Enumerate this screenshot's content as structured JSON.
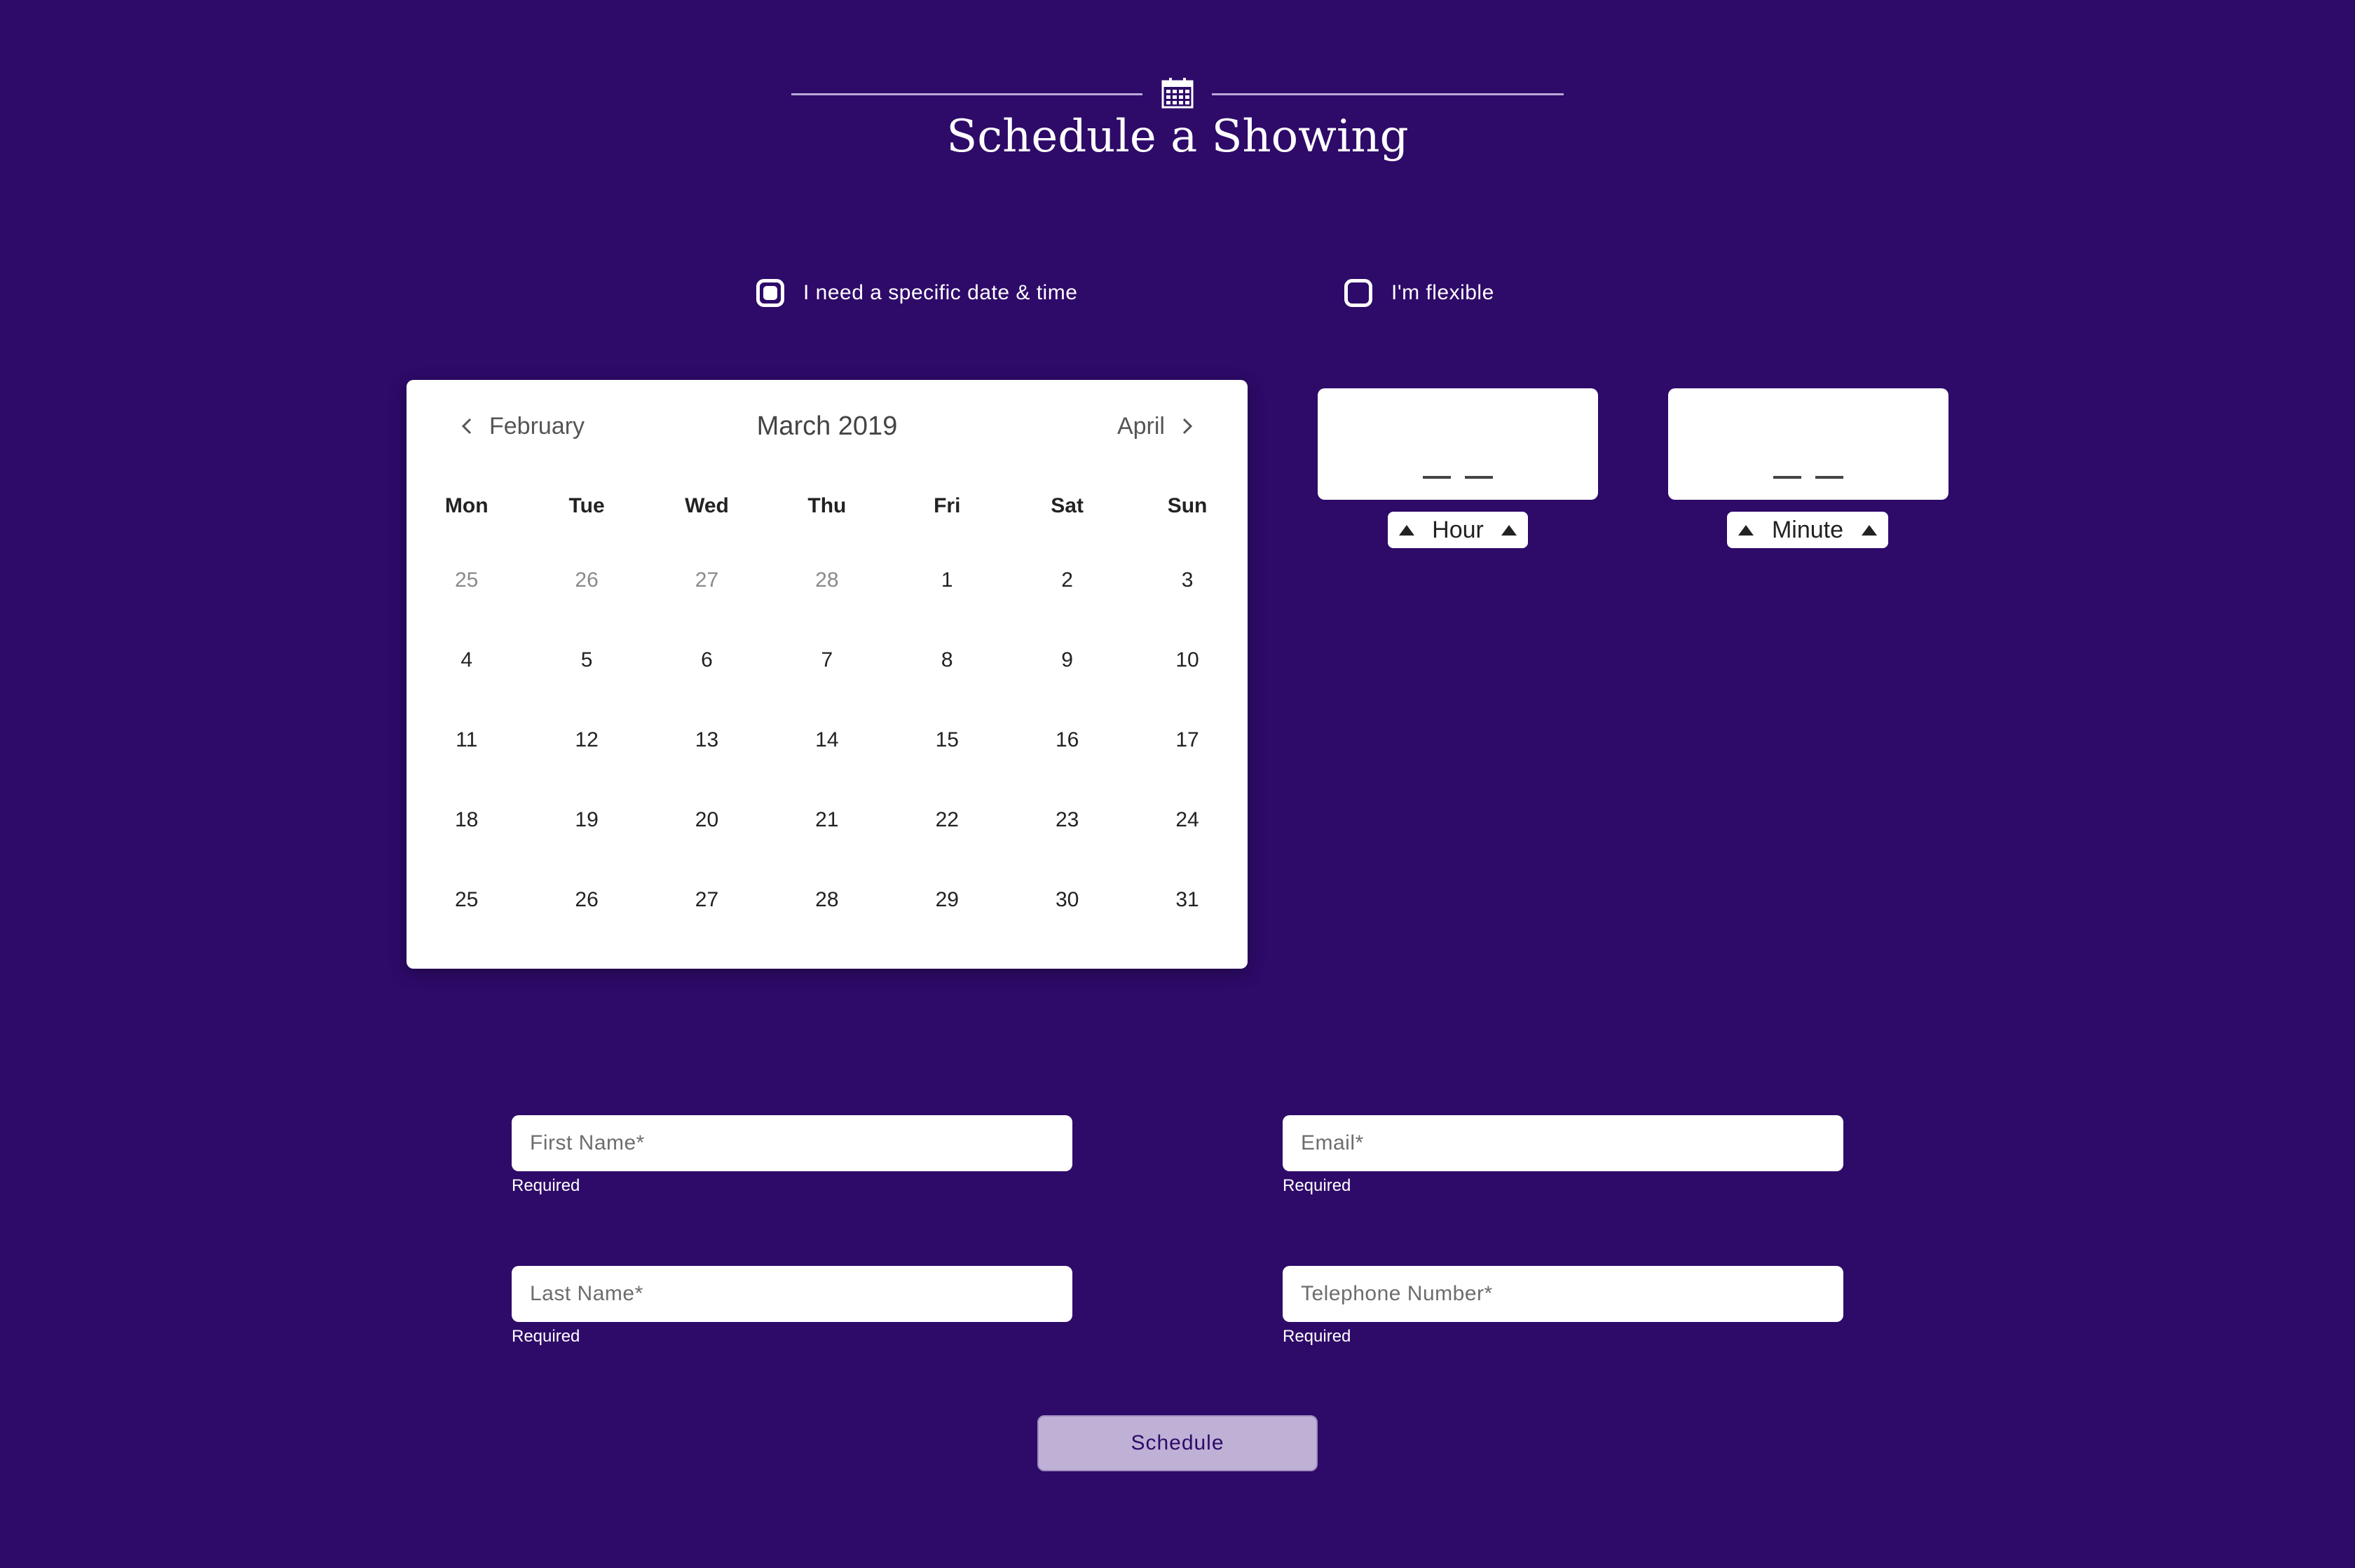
{
  "header": {
    "title": "Schedule a Showing",
    "icon": "calendar-icon"
  },
  "options": [
    {
      "label": "I need a specific date & time",
      "checked": true
    },
    {
      "label": "I'm flexible",
      "checked": false
    }
  ],
  "calendar": {
    "prev_label": "February",
    "month_label": "March 2019",
    "next_label": "April",
    "weekdays": [
      "Mon",
      "Tue",
      "Wed",
      "Thu",
      "Fri",
      "Sat",
      "Sun"
    ],
    "days": [
      {
        "n": "25",
        "muted": true
      },
      {
        "n": "26",
        "muted": true
      },
      {
        "n": "27",
        "muted": true
      },
      {
        "n": "28",
        "muted": true
      },
      {
        "n": "1"
      },
      {
        "n": "2"
      },
      {
        "n": "3"
      },
      {
        "n": "4"
      },
      {
        "n": "5"
      },
      {
        "n": "6"
      },
      {
        "n": "7"
      },
      {
        "n": "8"
      },
      {
        "n": "9"
      },
      {
        "n": "10"
      },
      {
        "n": "11"
      },
      {
        "n": "12"
      },
      {
        "n": "13"
      },
      {
        "n": "14"
      },
      {
        "n": "15"
      },
      {
        "n": "16"
      },
      {
        "n": "17"
      },
      {
        "n": "18"
      },
      {
        "n": "19"
      },
      {
        "n": "20"
      },
      {
        "n": "21"
      },
      {
        "n": "22"
      },
      {
        "n": "23"
      },
      {
        "n": "24"
      },
      {
        "n": "25"
      },
      {
        "n": "26"
      },
      {
        "n": "27"
      },
      {
        "n": "28"
      },
      {
        "n": "29"
      },
      {
        "n": "30"
      },
      {
        "n": "31"
      }
    ]
  },
  "time": {
    "hour_label": "Hour",
    "minute_label": "Minute"
  },
  "form": {
    "first_name_placeholder": "First Name*",
    "email_placeholder": "Email*",
    "last_name_placeholder": "Last Name*",
    "phone_placeholder": "Telephone Number*",
    "required_text": "Required",
    "submit_label": "Schedule"
  },
  "colors": {
    "background": "#2e0a69",
    "card": "#ffffff",
    "button": "#bfb1d6",
    "button_text": "#2e0a69"
  }
}
